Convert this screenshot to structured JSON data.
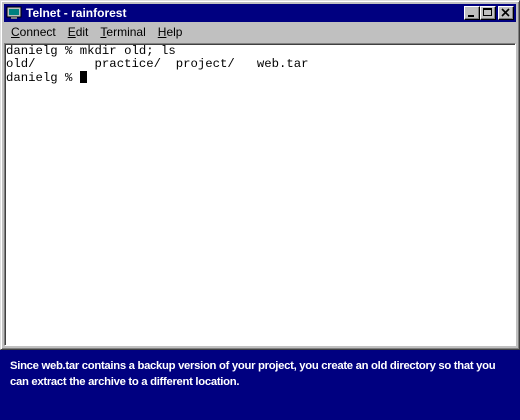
{
  "window": {
    "title": "Telnet - rainforest"
  },
  "menu": {
    "items": [
      {
        "mnemonic": "C",
        "rest": "onnect"
      },
      {
        "mnemonic": "E",
        "rest": "dit"
      },
      {
        "mnemonic": "T",
        "rest": "erminal"
      },
      {
        "mnemonic": "H",
        "rest": "elp"
      }
    ]
  },
  "terminal": {
    "lines": [
      "danielg % mkdir old; ls",
      "old/        practice/  project/   web.tar",
      "danielg % "
    ]
  },
  "caption": {
    "text": "Since web.tar contains a backup version of your project, you create an old directory so that you can extract the archive to a different location."
  },
  "colors": {
    "titlebar": "#000080",
    "caption_background": "#000080",
    "window_chrome": "#c0c0c0"
  }
}
